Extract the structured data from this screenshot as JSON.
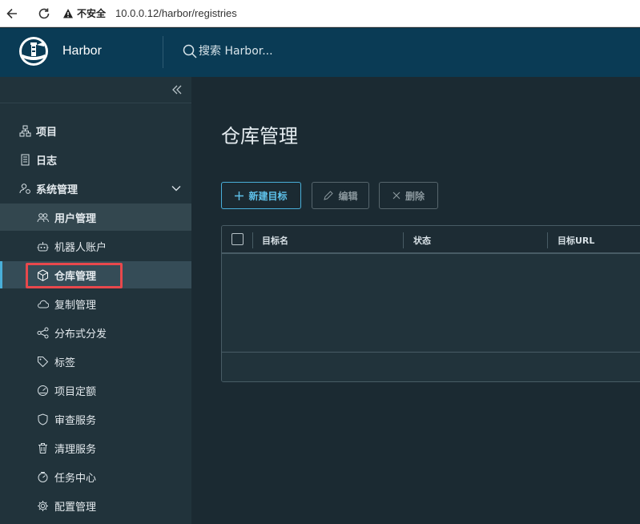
{
  "browser": {
    "security_label": "不安全",
    "url": "10.0.0.12/harbor/registries"
  },
  "header": {
    "app_name": "Harbor",
    "search_placeholder": "搜索 Harbor..."
  },
  "sidebar": {
    "items": [
      {
        "label": "项目",
        "icon": "projects-icon"
      },
      {
        "label": "日志",
        "icon": "logs-icon"
      },
      {
        "label": "系统管理",
        "icon": "system-admin-icon",
        "expanded": true
      }
    ],
    "sub_items": [
      {
        "label": "用户管理",
        "icon": "users-icon"
      },
      {
        "label": "机器人账户",
        "icon": "robot-icon"
      },
      {
        "label": "仓库管理",
        "icon": "registry-icon",
        "current": true
      },
      {
        "label": "复制管理",
        "icon": "replication-icon"
      },
      {
        "label": "分布式分发",
        "icon": "distribution-icon"
      },
      {
        "label": "标签",
        "icon": "tag-icon"
      },
      {
        "label": "项目定额",
        "icon": "quota-icon"
      },
      {
        "label": "审查服务",
        "icon": "shield-icon"
      },
      {
        "label": "清理服务",
        "icon": "trash-icon"
      },
      {
        "label": "任务中心",
        "icon": "job-center-icon"
      },
      {
        "label": "配置管理",
        "icon": "gear-icon"
      }
    ]
  },
  "main": {
    "title": "仓库管理",
    "buttons": {
      "new": "新建目标",
      "edit": "编辑",
      "delete": "删除"
    },
    "table": {
      "columns": [
        "目标名",
        "状态",
        "目标URL"
      ],
      "rows": []
    }
  },
  "colors": {
    "header_bg": "#0a3b55",
    "sidebar_bg": "#21333b",
    "main_bg": "#1b2a32",
    "accent": "#49afd9",
    "highlight_box": "#e8484c"
  }
}
